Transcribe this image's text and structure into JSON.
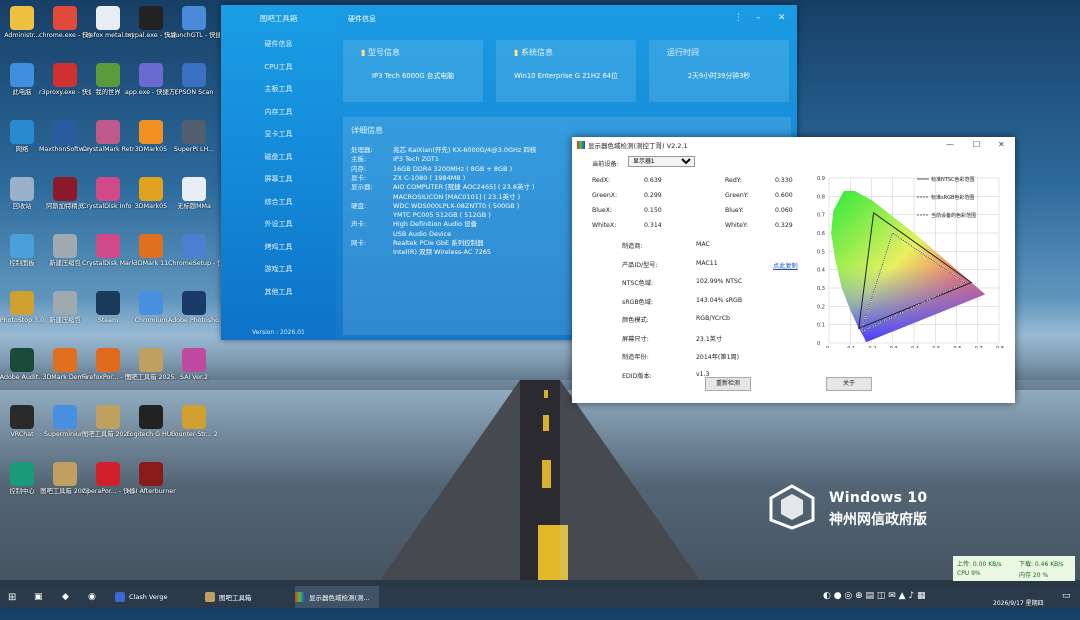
{
  "desktop": {
    "icons": [
      {
        "label": "Administr...",
        "icon": "user-folder-icon",
        "color": "#f0c040"
      },
      {
        "label": "chrome.exe - 快捷方式",
        "icon": "chrome-icon",
        "color": "#e04a3a"
      },
      {
        "label": "Firefox metal.txt",
        "icon": "text-file-icon",
        "color": "#e9eef4"
      },
      {
        "label": "mypal.exe - 快捷方式",
        "icon": "mypal-icon",
        "color": "#222222"
      },
      {
        "label": "LaunchGTL - 快捷方式",
        "icon": "launch-icon",
        "color": "#4a8ad8"
      },
      {
        "label": "此电脑",
        "icon": "computer-icon",
        "color": "#3f8ee0"
      },
      {
        "label": "r3proxy.exe - 快捷方式",
        "icon": "proxy-icon",
        "color": "#d03030"
      },
      {
        "label": "我的世界",
        "icon": "minecraft-icon",
        "color": "#5a9a3a"
      },
      {
        "label": "app.exe - 快捷方式",
        "icon": "app-icon",
        "color": "#6a6ad0"
      },
      {
        "label": "EPSON Scan",
        "icon": "scanner-icon",
        "color": "#3a70c0"
      },
      {
        "label": "网络",
        "icon": "network-icon",
        "color": "#2a8ad0"
      },
      {
        "label": "MaxthonSoftware - 快捷方式",
        "icon": "maxthon-icon",
        "color": "#2a5aa0"
      },
      {
        "label": "CrystalMark Retro Alt...",
        "icon": "crystal-icon",
        "color": "#c05a8a"
      },
      {
        "label": "3DMark05",
        "icon": "3dmark-icon",
        "color": "#f09020"
      },
      {
        "label": "SuperPI LH...",
        "icon": "superpi-icon",
        "color": "#506070"
      },
      {
        "label": "回收站",
        "icon": "recycle-bin-icon",
        "color": "#9ab0c8"
      },
      {
        "label": "阿斯加特精灵",
        "icon": "game-icon",
        "color": "#8a1a2a"
      },
      {
        "label": "CrystalDisk Info 8.x",
        "icon": "crystaldisk-icon",
        "color": "#d04a8a"
      },
      {
        "label": "3DMark05",
        "icon": "3dmark-icon",
        "color": "#e0a020"
      },
      {
        "label": "无标题MMa",
        "icon": "text-file-icon",
        "color": "#e9eef4"
      },
      {
        "label": "控制面板",
        "icon": "control-panel-icon",
        "color": "#4aa0d8"
      },
      {
        "label": "新建压缩包",
        "icon": "archive-icon",
        "color": "#a0a8b0"
      },
      {
        "label": "CrystalDisk Mark 8.x",
        "icon": "crystaldisk-icon",
        "color": "#d04a8a"
      },
      {
        "label": "3DMark 11",
        "icon": "3dmark-icon",
        "color": "#e07020"
      },
      {
        "label": "ChromeSetup - 快捷方式",
        "icon": "chrome-icon",
        "color": "#4a80d0"
      },
      {
        "label": "PhotoStop 3.0",
        "icon": "photostop-icon",
        "color": "#d0a030"
      },
      {
        "label": "新建压缩包",
        "icon": "archive-icon",
        "color": "#a0a8b0"
      },
      {
        "label": "Steam",
        "icon": "steam-icon",
        "color": "#1a3a5a"
      },
      {
        "label": "Chromium",
        "icon": "chromium-icon",
        "color": "#4a90e0"
      },
      {
        "label": "Adobe Photosho...",
        "icon": "photoshop-icon",
        "color": "#1a3a6a"
      },
      {
        "label": "Adobe Audit...",
        "icon": "audition-icon",
        "color": "#1a4a3a"
      },
      {
        "label": "3DMark Demo",
        "icon": "3dmark-icon",
        "color": "#e07020"
      },
      {
        "label": "FirefoxPor... - 快捷方式",
        "icon": "firefox-icon",
        "color": "#e06a20"
      },
      {
        "label": "图吧工具箱 2025.exe...",
        "icon": "toolbox-icon",
        "color": "#c0a060"
      },
      {
        "label": "SAI Ver.2",
        "icon": "sai-icon",
        "color": "#c04aa0"
      },
      {
        "label": "VRChat",
        "icon": "vrchat-icon",
        "color": "#2a2a2a"
      },
      {
        "label": "Superminium",
        "icon": "superminium-icon",
        "color": "#4a90e0"
      },
      {
        "label": "图吧工具箱 2025.exe...",
        "icon": "toolbox-icon",
        "color": "#c0a060"
      },
      {
        "label": "Logitech G HUB",
        "icon": "logitech-icon",
        "color": "#222222"
      },
      {
        "label": "Counter-Str... 2",
        "icon": "counterstrike-icon",
        "color": "#d0a030"
      },
      {
        "label": "控制中心",
        "icon": "control-center-icon",
        "color": "#1a9a7a"
      },
      {
        "label": "图吧工具箱 2023",
        "icon": "toolbox-icon",
        "color": "#c0a060"
      },
      {
        "label": "OperaPor... - 快捷方式",
        "icon": "opera-icon",
        "color": "#d0202a"
      },
      {
        "label": "MSI Afterburner",
        "icon": "afterburner-icon",
        "color": "#8a1a1a"
      }
    ]
  },
  "toolbox": {
    "brand": "图吧工具箱",
    "title": "硬件信息",
    "nav": [
      "硬件信息",
      "CPU工具",
      "主板工具",
      "内存工具",
      "显卡工具",
      "磁盘工具",
      "屏幕工具",
      "综合工具",
      "外设工具",
      "烤鸡工具",
      "游戏工具",
      "其他工具"
    ],
    "version": "Version : 2026.01",
    "cards": [
      {
        "title": "型号信息",
        "value": "IP3 Tech 6000G 台式电脑"
      },
      {
        "title": "系统信息",
        "value": "Win10 Enterprise G 21H2 64位"
      },
      {
        "title": "运行时间",
        "value": "2天9小时39分钟3秒"
      }
    ],
    "detail_title": "详细信息",
    "details": [
      {
        "k": "处理器:",
        "v": "兆芯 KaiXian(开先) KX-6000G/4@3.0GHz 四核"
      },
      {
        "k": "主板:",
        "v": "IP3 Tech ZGT1"
      },
      {
        "k": "内存:",
        "v": "16GB DDR4 3200MHz ( 8GB + 8GB )"
      },
      {
        "k": "显卡:",
        "v": "ZX C-1080 ( 1984MB )"
      },
      {
        "k": "显示器:",
        "v": "AIO COMPUTER [冠捷 AOC2465] ( 23.8英寸 )"
      },
      {
        "k": "",
        "v": "MACROSILICON [MAC0101] ( 23.1英寸 )"
      },
      {
        "k": "硬盘:",
        "v": "WDC WDS000LPLX-08ZNTT0 ( 500GB )"
      },
      {
        "k": "",
        "v": "YMTC PC005 512GB ( 512GB )"
      },
      {
        "k": "声卡:",
        "v": "High Definition Audio 设备"
      },
      {
        "k": "",
        "v": "USB Audio Device"
      },
      {
        "k": "网卡:",
        "v": "Realtek PCIe GbE 系列控制器"
      },
      {
        "k": "",
        "v": "Intel(R) 双频 Wireless-AC 7265"
      }
    ]
  },
  "gamut": {
    "title": "显示器色域检测(测控丁哥) V2.2.1",
    "device_label": "当前设备:",
    "device_value": "显示器1",
    "coords_left": [
      {
        "k": "RedX:",
        "v": "0.639"
      },
      {
        "k": "GreenX:",
        "v": "0.299"
      },
      {
        "k": "BlueX:",
        "v": "0.150"
      },
      {
        "k": "WhiteX:",
        "v": "0.314"
      }
    ],
    "coords_right": [
      {
        "k": "RedY:",
        "v": "0.330"
      },
      {
        "k": "GreenY:",
        "v": "0.600"
      },
      {
        "k": "BlueY:",
        "v": "0.060"
      },
      {
        "k": "WhiteY:",
        "v": "0.329"
      }
    ],
    "info": [
      {
        "k": "制造商:",
        "v": "MAC"
      },
      {
        "k": "产品ID/型号:",
        "v": "MAC11"
      },
      {
        "k": "NTSC色域:",
        "v": "102.99% NTSC"
      },
      {
        "k": "sRGB色域:",
        "v": "143.04% sRGB"
      },
      {
        "k": "颜色模式:",
        "v": "RGB/YCrCb"
      },
      {
        "k": "屏幕尺寸:",
        "v": "23.1英寸"
      },
      {
        "k": "制造年份:",
        "v": "2014年(第1周)"
      },
      {
        "k": "EDID版本:",
        "v": "v1.3"
      }
    ],
    "copy_link": "点此复制",
    "redetect_btn": "重新检测",
    "close_btn": "关于",
    "legend": [
      "标准NTSC色彩范围",
      "标准sRGB色彩范围",
      "当前设备的色彩范围"
    ],
    "axis_ticks_x": [
      "0",
      "0.1",
      "0.2",
      "0.3",
      "0.4",
      "0.5",
      "0.6",
      "0.7",
      "0.8"
    ],
    "axis_ticks_y": [
      "0",
      "0.1",
      "0.2",
      "0.3",
      "0.4",
      "0.5",
      "0.6",
      "0.7",
      "0.8",
      "0.9"
    ]
  },
  "watermark": {
    "line1": "Windows 10",
    "line2": "神州网信政府版"
  },
  "netmon": {
    "up": "上传: 0.00 KB/s",
    "down": "下载: 0.46 KB/s",
    "cpu": "CPU 9%",
    "mem": "内存 20 %"
  },
  "taskbar": {
    "apps": [
      {
        "label": "Clash Verge",
        "color": "#3a6ad0"
      },
      {
        "label": "图吧工具箱",
        "color": "#c0a060"
      },
      {
        "label": "显示器色域检测(测...",
        "color": "#e0e0e0"
      }
    ],
    "time": "",
    "date": "2026/9/17 星期四"
  }
}
